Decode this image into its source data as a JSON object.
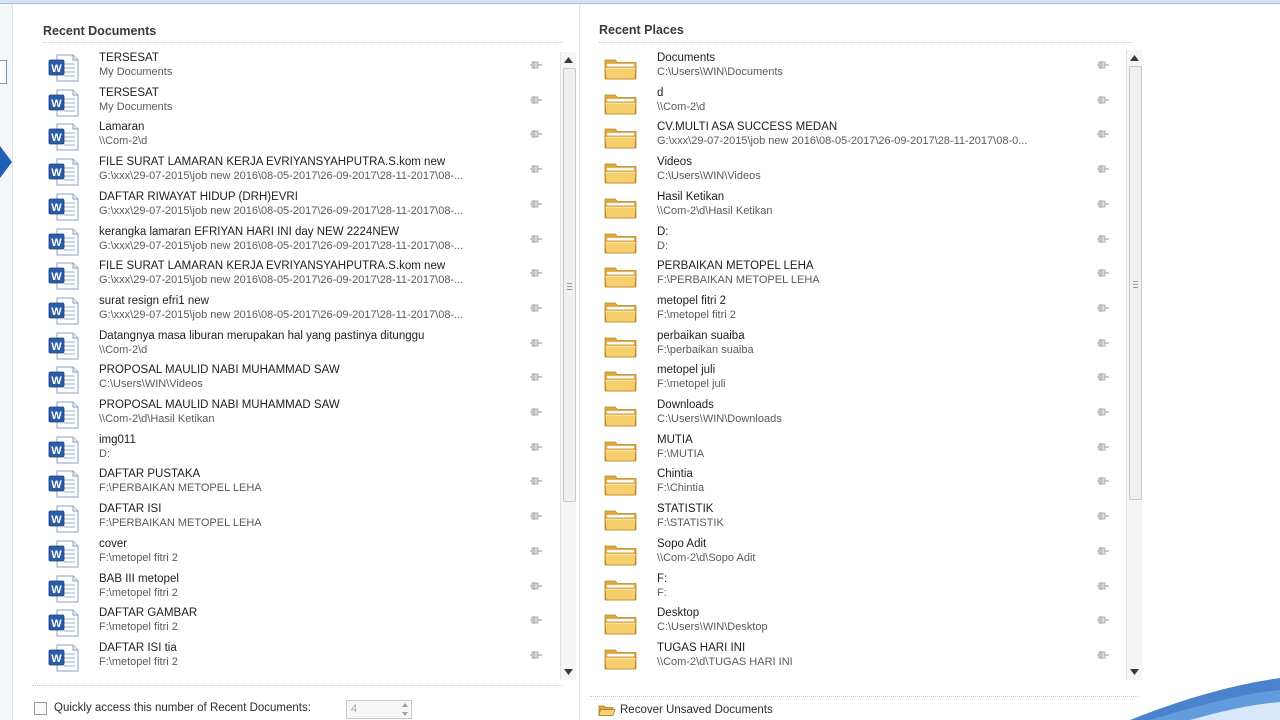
{
  "recent_documents": {
    "title": "Recent Documents",
    "items": [
      {
        "name": "TERSESAT",
        "path": "My Documents"
      },
      {
        "name": "TERSESAT",
        "path": "My Documents"
      },
      {
        "name": "Lamaran",
        "path": "\\\\Com-2\\d"
      },
      {
        "name": "FILE SURAT LAMARAN KERJA EVRIYANSYAHPUTRA.S.kom new",
        "path": "G:\\xxx\\29-07-2015\\job new 2016\\08-05-2017\\26-09-2017\\28-11-2017\\08-..."
      },
      {
        "name": "DAFTAR RIWAYAT HIDUP (DRH)EVRI",
        "path": "G:\\xxx\\29-07-2015\\job new 2016\\08-05-2017\\26-09-2017\\28-11-2017\\08-..."
      },
      {
        "name": "kerangka lamaran EFRIYAN HARI INI day NEW 2224NEW",
        "path": "G:\\xxx\\29-07-2015\\job new 2016\\08-05-2017\\26-09-2017\\28-11-2017\\08-..."
      },
      {
        "name": "FILE SURAT LAMARAN KERJA EVRIYANSYAHPUTRA.S.kom new",
        "path": "G:\\xxx\\29-07-2015\\job new 2016\\08-05-2017\\26-09-2017\\28-11-2017\\08-..."
      },
      {
        "name": "surat resign efri1 new",
        "path": "G:\\xxx\\29-07-2015\\job new 2016\\08-05-2017\\26-09-2017\\28-11-2017\\08-..."
      },
      {
        "name": "Datangnya masa  liburan merupakan hal yang pastinya ditunggu",
        "path": "\\\\Com-2\\d"
      },
      {
        "name": "PROPOSAL MAULID NABI MUHAMMAD SAW",
        "path": "C:\\Users\\WIN\\Videos"
      },
      {
        "name": "PROPOSAL MAULID NABI MUHAMMAD SAW",
        "path": "\\\\Com-2\\d\\Hasil Ketikan"
      },
      {
        "name": "img011",
        "path": "D:"
      },
      {
        "name": "DAFTAR PUSTAKA",
        "path": "F:\\PERBAIKAN METOPEL LEHA"
      },
      {
        "name": "DAFTAR ISI",
        "path": "F:\\PERBAIKAN METOPEL LEHA"
      },
      {
        "name": "cover",
        "path": "F:\\metopel fitri 2"
      },
      {
        "name": "BAB III metopel",
        "path": "F:\\metopel fitri 2"
      },
      {
        "name": "DAFTAR GAMBAR",
        "path": "F:\\metopel fitri 2"
      },
      {
        "name": "DAFTAR ISI tia",
        "path": "F:\\metopel fitri 2"
      }
    ]
  },
  "recent_places": {
    "title": "Recent Places",
    "items": [
      {
        "name": "Documents",
        "path": "C:\\Users\\WIN\\Documents"
      },
      {
        "name": "d",
        "path": "\\\\Com-2\\d"
      },
      {
        "name": "CV.MULTI ASA SUCCESS MEDAN",
        "path": "G:\\xxx\\29-07-2015\\job new 2016\\08-05-2017\\26-09-2017\\28-11-2017\\08-0..."
      },
      {
        "name": "Videos",
        "path": "C:\\Users\\WIN\\Videos"
      },
      {
        "name": "Hasil Ketikan",
        "path": "\\\\Com-2\\d\\Hasil Ketikan"
      },
      {
        "name": "D:",
        "path": "D:"
      },
      {
        "name": "PERBAIKAN METOPEL LEHA",
        "path": "F:\\PERBAIKAN METOPEL LEHA"
      },
      {
        "name": "metopel fitri 2",
        "path": "F:\\metopel fitri 2"
      },
      {
        "name": "perbaikan suaiba",
        "path": "F:\\perbaikan suaiba"
      },
      {
        "name": "metopel juli",
        "path": "F:\\metopel juli"
      },
      {
        "name": "Downloads",
        "path": "C:\\Users\\WIN\\Downloads"
      },
      {
        "name": "MUTIA",
        "path": "F:\\MUTIA"
      },
      {
        "name": "Chintia",
        "path": "F:\\Chintia"
      },
      {
        "name": "STATISTIK",
        "path": "F:\\STATISTIK"
      },
      {
        "name": "Sopo Adit",
        "path": "\\\\Com-2\\d\\Sopo Adit"
      },
      {
        "name": "F:",
        "path": "F:"
      },
      {
        "name": "Desktop",
        "path": "C:\\Users\\WIN\\Desktop"
      },
      {
        "name": "TUGAS HARI INI",
        "path": "\\\\Com-2\\d\\TUGAS HARI INI"
      }
    ]
  },
  "footer": {
    "quick_access_label": "Quickly access this number of Recent Documents:",
    "quick_access_value": "4",
    "recover_label": "Recover Unsaved Documents"
  },
  "icons": {
    "document": "word-document-icon",
    "folder": "folder-icon",
    "pin": "pin-icon",
    "recover": "folder-open-icon"
  },
  "colors": {
    "word_blue": "#2a5caa",
    "folder_yellow": "#f3c55c",
    "accent_blue": "#1f5fb5"
  }
}
